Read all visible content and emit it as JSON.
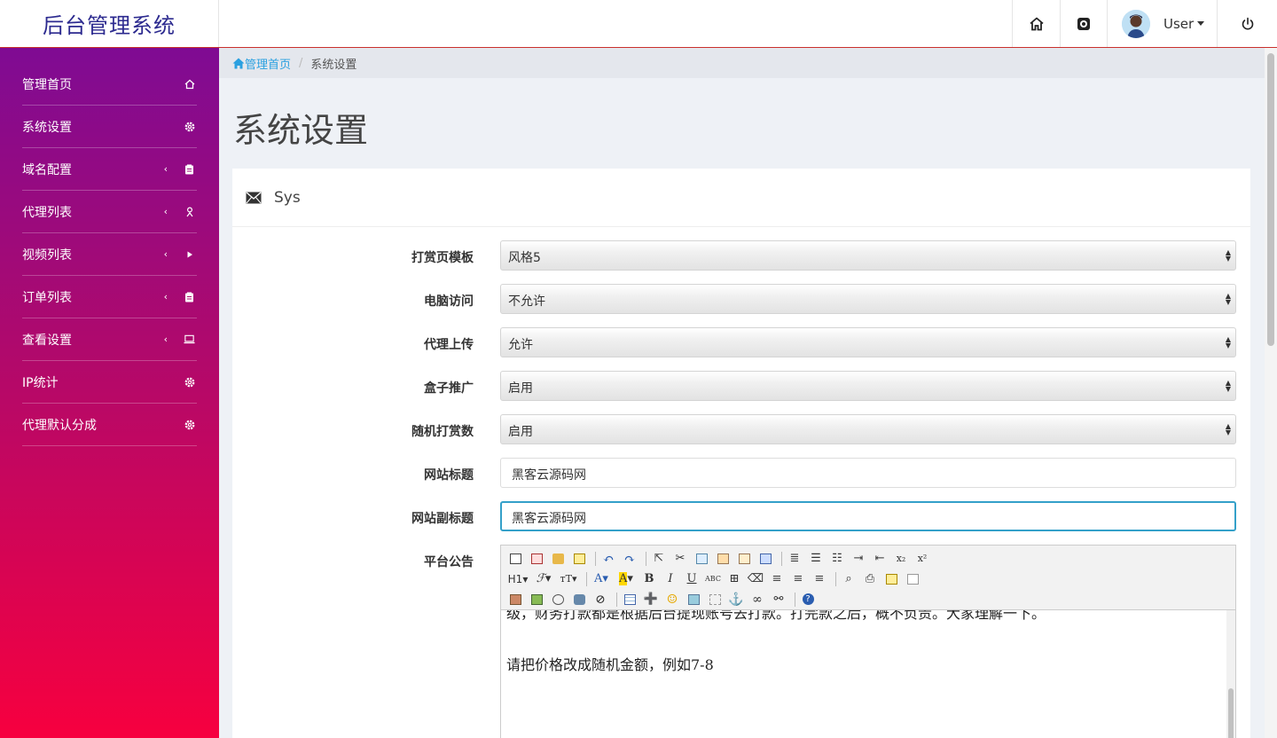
{
  "app": {
    "title": "后台管理系统"
  },
  "topnav": {
    "user_label": "User",
    "home_icon": "home-icon",
    "settings_icon": "gear-icon",
    "power_icon": "power-icon"
  },
  "sidebar": {
    "items": [
      {
        "label": "管理首页",
        "icon": "home-icon",
        "has_submenu": false
      },
      {
        "label": "系统设置",
        "icon": "gear-icon",
        "has_submenu": false
      },
      {
        "label": "域名配置",
        "icon": "clipboard-icon",
        "has_submenu": true
      },
      {
        "label": "代理列表",
        "icon": "user-icon",
        "has_submenu": true
      },
      {
        "label": "视频列表",
        "icon": "play-icon",
        "has_submenu": true
      },
      {
        "label": "订单列表",
        "icon": "clipboard-icon",
        "has_submenu": true
      },
      {
        "label": "查看设置",
        "icon": "laptop-icon",
        "has_submenu": true
      },
      {
        "label": "IP统计",
        "icon": "gear-icon",
        "has_submenu": false
      },
      {
        "label": "代理默认分成",
        "icon": "gear-icon",
        "has_submenu": false
      }
    ]
  },
  "breadcrumb": {
    "home": "管理首页",
    "separator": "/",
    "current": "系统设置"
  },
  "page": {
    "title": "系统设置"
  },
  "panel": {
    "title": "Sys",
    "icon": "envelope-icon"
  },
  "form": {
    "fields": [
      {
        "label": "打赏页模板",
        "type": "select",
        "value": "风格5"
      },
      {
        "label": "电脑访问",
        "type": "select",
        "value": "不允许"
      },
      {
        "label": "代理上传",
        "type": "select",
        "value": "允许"
      },
      {
        "label": "盒子推广",
        "type": "select",
        "value": "启用"
      },
      {
        "label": "随机打赏数",
        "type": "select",
        "value": "启用"
      },
      {
        "label": "网站标题",
        "type": "text",
        "value": "黑客云源码网"
      },
      {
        "label": "网站副标题",
        "type": "text",
        "value": "黑客云源码网"
      },
      {
        "label": "平台公告",
        "type": "editor"
      }
    ],
    "editor": {
      "lines": [
        "级，财务打款都是根据后台提现账号去打款。打完款之后，概不负责。大家理解一下。",
        "请把价格改成随机金额，例如7-8"
      ],
      "toolbar_heading": "H1",
      "toolbar_items_row1": [
        "source",
        "fullscreen",
        "cleardoc",
        "pasteplain",
        "undo",
        "redo",
        "selectall",
        "cut",
        "copy",
        "paste",
        "pastetext",
        "pasteword",
        "justify",
        "insertorderedlist",
        "insertunorderedlist",
        "indent",
        "outdent",
        "subscript",
        "superscript"
      ],
      "toolbar_items_row2": [
        "paragraph",
        "fontfamily",
        "fontsize",
        "forecolor",
        "backcolor",
        "bold",
        "italic",
        "underline",
        "strikethrough",
        "border",
        "eraser",
        "justifyleft",
        "justifycenter",
        "justifyright",
        "preview",
        "print",
        "template",
        "code"
      ],
      "toolbar_items_row3": [
        "image",
        "multiimage",
        "flash",
        "media",
        "attachment",
        "table",
        "insertrow",
        "emotion",
        "picture",
        "pagebreak",
        "anchor",
        "link",
        "unlink",
        "help"
      ]
    }
  }
}
